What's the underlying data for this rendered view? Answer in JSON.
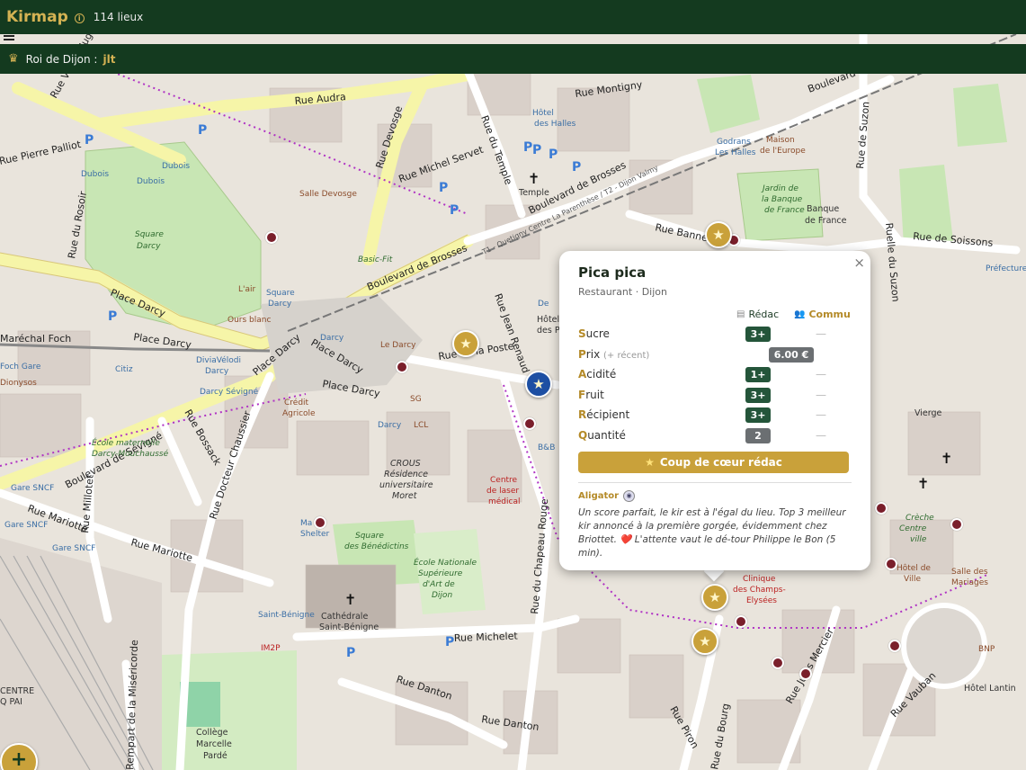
{
  "header": {
    "brand": "Kirmap",
    "place_count": "114 lieux",
    "king_label": "Roi de Dijon :",
    "king_name": "jlt"
  },
  "map": {
    "streets": [
      "Rue Audra",
      "Rue Montigny",
      "Boulevard de Brosses",
      "Rue Michel Servet",
      "Rue du Temple",
      "Rue Devosge",
      "Rue Pierre Palliot",
      "Rue Victor Hugo",
      "Rue du Rosoir",
      "Place Darcy",
      "Rue Maréchal Foch",
      "Rue de la Poste",
      "Boulevard de Sévigné",
      "Rue Bossack",
      "Rue Docteur Chaussier",
      "Rue Millotet",
      "Rue Mariotte",
      "Rue du Chapeau Rouge",
      "Rue Michelet",
      "Rue Danton",
      "Rue Piron",
      "Rue du Bourg",
      "Rue Vauban",
      "Rue Jules Mercier",
      "Rue de Soissons",
      "Rue Bannelier",
      "Rue de Suzon",
      "Ruelle du Suzon",
      "Rue Jean Renaud",
      "Rempart de la Miséricorde",
      "Boulevard"
    ],
    "places": [
      "Square Darcy",
      "L'air",
      "Ours blanc",
      "Salle Devosge",
      "Basic-Fit",
      "Temple",
      "Hôtel des Halles",
      "Godrans Les Halles",
      "Maison de l'Europe",
      "Jardin de la Banque de France",
      "Banque de France",
      "Le Darcy",
      "Crédit Agricole",
      "Darcy",
      "DiviaVélodi Darcy",
      "Citiz",
      "Darcy Sévigné",
      "Foch Gare",
      "Dionysos",
      "Square Darcy",
      "École maternelle Darcy-Mouchaussé",
      "CROUS Résidence universitaire Moret",
      "Centre de laser médical",
      "Square des Bénédictins",
      "École Nationale Supérieure d'Art de Dijon",
      "Cathédrale Saint-Bénigne",
      "Saint-Bénigne",
      "IM2P",
      "Gare SNCF",
      "Collège Marcelle Pardé",
      "Clinique des Champs-Élysées",
      "Crèche Centre ville",
      "Hôtel de Ville",
      "Salle des Mariages",
      "Hôtel Lantin",
      "BNP",
      "Vierge",
      "Préfecture",
      "CENTRE Q PAI",
      "LCL",
      "SG",
      "B&B",
      "Mail Shelter",
      "Dubois",
      "Square Darcy",
      "T1 - Quetigny Centre La Parenthèse / T2 - Dijon Valmy"
    ],
    "markers": [
      "dot",
      "dot",
      "dot",
      "dot",
      "dot",
      "dot",
      "dot",
      "dot",
      "dot",
      "dot",
      "dot",
      "dot"
    ]
  },
  "popup": {
    "name": "Pica pica",
    "subtitle": "Restaurant · Dijon",
    "close": "×",
    "col_redac": "Rédac",
    "col_commu": "Commu",
    "criteria": [
      {
        "first": "S",
        "rest": "ucre",
        "note": "",
        "redac": "3+",
        "commu": "—",
        "kind": "green"
      },
      {
        "first": "P",
        "rest": "rix",
        "note": "(+ récent)",
        "redac": "6.00 €",
        "commu": "",
        "kind": "price"
      },
      {
        "first": "A",
        "rest": "cidité",
        "note": "",
        "redac": "1+",
        "commu": "—",
        "kind": "green"
      },
      {
        "first": "F",
        "rest": "ruit",
        "note": "",
        "redac": "3+",
        "commu": "—",
        "kind": "green"
      },
      {
        "first": "R",
        "rest": "écipient",
        "note": "",
        "redac": "3+",
        "commu": "—",
        "kind": "green"
      },
      {
        "first": "Q",
        "rest": "uantité",
        "note": "",
        "redac": "2",
        "commu": "—",
        "kind": "gray"
      }
    ],
    "cta": "Coup de cœur rédac",
    "review_author": "Aligator",
    "review_text": "Un score parfait, le kir est à l'égal du lieu. Top 3 meilleur kir annoncé à la première gorgée, évidemment chez Briottet. ❤️ L'attente vaut le dé-tour Philippe le Bon (5 min)."
  },
  "fab": {
    "label": "+"
  },
  "colors": {
    "header": "#143a1f",
    "gold": "#c9a13a",
    "green_badge": "#24553a",
    "marker": "#7a1f2b"
  }
}
